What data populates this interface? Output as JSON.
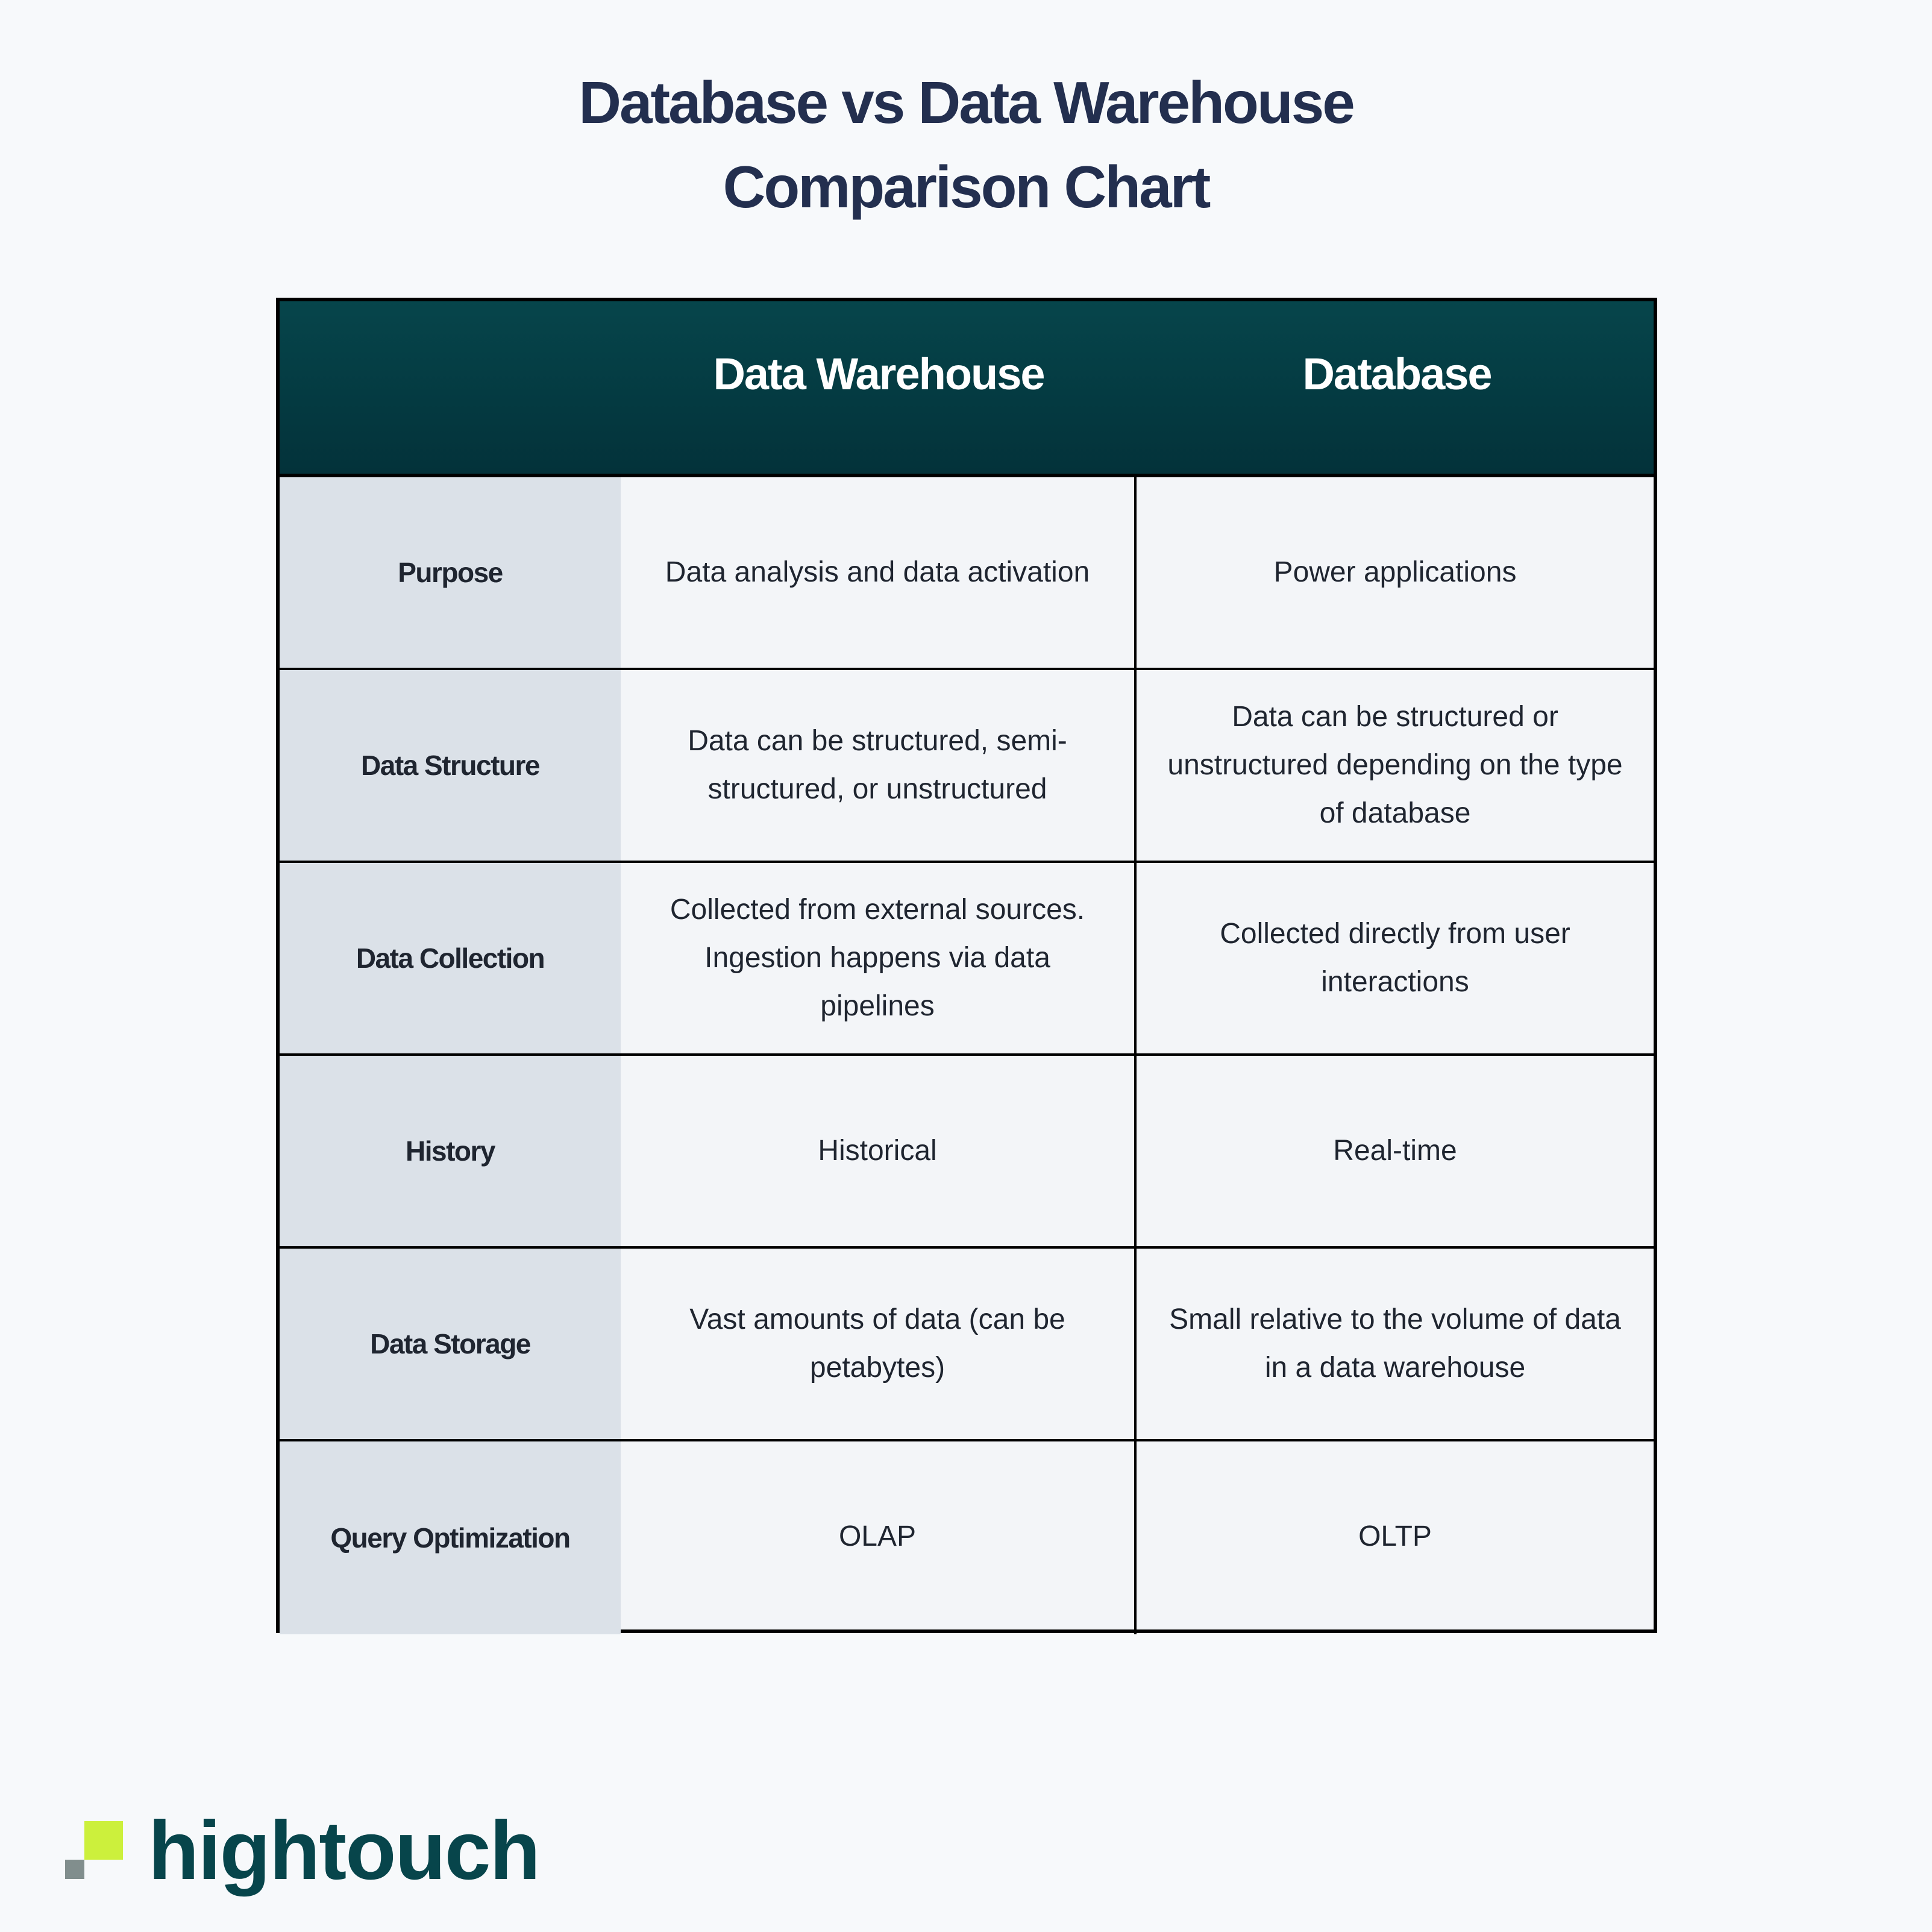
{
  "title": {
    "line1": "Database vs Data Warehouse",
    "line2": "Comparison Chart"
  },
  "table": {
    "headers": [
      "",
      "Data Warehouse",
      "Database"
    ],
    "rows": [
      {
        "label": "Purpose",
        "data_warehouse": "Data analysis and data activation",
        "database": "Power applications"
      },
      {
        "label": "Data Structure",
        "data_warehouse": "Data can be structured, semi-structured, or unstructured",
        "database": "Data can be structured or unstructured depending on the type of database"
      },
      {
        "label": "Data Collection",
        "data_warehouse": "Collected from external sources. Ingestion happens via data pipelines",
        "database": "Collected directly from user interactions"
      },
      {
        "label": "History",
        "data_warehouse": "Historical",
        "database": "Real-time"
      },
      {
        "label": "Data Storage",
        "data_warehouse": "Vast amounts of data (can be petabytes)",
        "database": "Small relative to the volume of data in a data warehouse"
      },
      {
        "label": "Query Optimization",
        "data_warehouse": "OLAP",
        "database": "OLTP"
      }
    ]
  },
  "brand": {
    "name": "hightouch",
    "logo_icon": "hightouch-logo-mark",
    "colors": {
      "lime": "#ccf03c",
      "gray": "#818e8d",
      "teal": "#07454b",
      "header": "#05414a",
      "title": "#232f4f"
    }
  }
}
